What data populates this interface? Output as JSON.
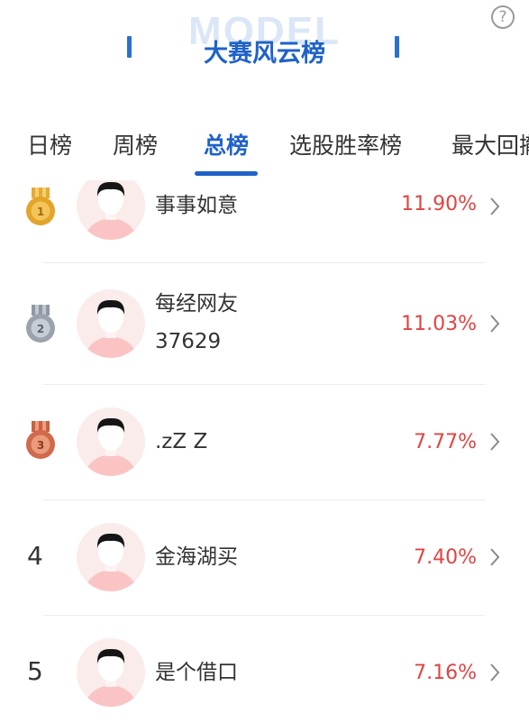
{
  "header": {
    "watermark": "MODEL",
    "title": "大赛风云榜",
    "help_symbol": "?"
  },
  "tabs": [
    {
      "label": "日榜"
    },
    {
      "label": "周榜"
    },
    {
      "label": "总榜",
      "active": true
    },
    {
      "label": "选股胜率榜"
    },
    {
      "label": "最大回撤"
    }
  ],
  "rankings": [
    {
      "rank": "1",
      "medal": "gold",
      "name": "事事如意",
      "return": "11.90%"
    },
    {
      "rank": "2",
      "medal": "silver",
      "name": "每经网友 37629",
      "name_line1": "每经网友",
      "name_line2": "37629",
      "return": "11.03%"
    },
    {
      "rank": "3",
      "medal": "bronze",
      "name": ".zZ Z",
      "return": "7.77%"
    },
    {
      "rank": "4",
      "name": "金海湖买",
      "return": "7.40%"
    },
    {
      "rank": "5",
      "name": "是个借口",
      "return": "7.16%"
    }
  ],
  "colors": {
    "accent": "#1f62c8",
    "return_up": "#e04444",
    "gold": "#e2a52a",
    "silver": "#9aa3ad",
    "bronze": "#d06a4d"
  },
  "icons": {
    "help": "question-circle-icon",
    "chevron": "chevron-right-icon",
    "avatar": "default-user-avatar-icon",
    "medal": "medal-icon"
  }
}
